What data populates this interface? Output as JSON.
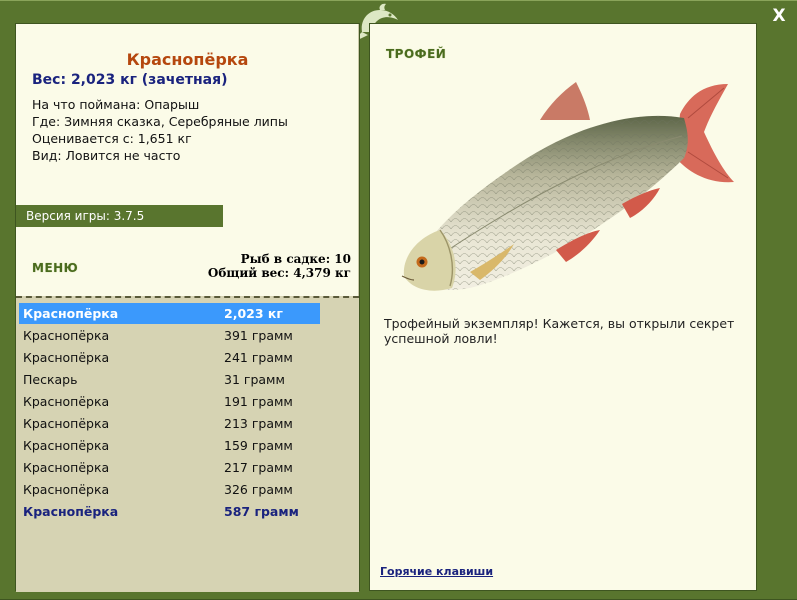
{
  "window": {
    "close_label": "X",
    "logo_icon": "fish-logo-icon"
  },
  "fish": {
    "name": "Краснопёрка",
    "weight": "Вес: 2,023 кг (зачетная)",
    "bait": "На что поймана: Опарыш",
    "location": "Где: Зимняя сказка, Серебряные липы",
    "rated_from": "Оценивается с: 1,651 кг",
    "species_note": "Вид: Ловится не часто"
  },
  "version": "Версия игры: 3.7.5",
  "menu_label": "МЕНЮ",
  "keepnet": {
    "count": "Рыб в садке: 10",
    "total_weight": "Общий вес: 4,379 кг"
  },
  "catch_list": [
    {
      "name": "Краснопёрка",
      "weight": "2,023 кг",
      "state": "selected"
    },
    {
      "name": "Краснопёрка",
      "weight": "391 грамм",
      "state": "normal"
    },
    {
      "name": "Краснопёрка",
      "weight": "241 грамм",
      "state": "normal"
    },
    {
      "name": "Пескарь",
      "weight": "31 грамм",
      "state": "normal"
    },
    {
      "name": "Краснопёрка",
      "weight": "191 грамм",
      "state": "normal"
    },
    {
      "name": "Краснопёрка",
      "weight": "213 грамм",
      "state": "normal"
    },
    {
      "name": "Краснопёрка",
      "weight": "159 грамм",
      "state": "normal"
    },
    {
      "name": "Краснопёрка",
      "weight": "217 грамм",
      "state": "normal"
    },
    {
      "name": "Краснопёрка",
      "weight": "326 грамм",
      "state": "normal"
    },
    {
      "name": "Краснопёрка",
      "weight": "587 грамм",
      "state": "highlighted"
    }
  ],
  "trophy": {
    "label": "ТРОФЕЙ",
    "description": "Трофейный экземпляр! Кажется, вы открыли секрет успешной ловли!",
    "image_icon": "rudd-fish-image"
  },
  "hotkeys_link": "Горячие клавиши",
  "colors": {
    "frame": "#59752e",
    "panel": "#fbfbe8",
    "list_bg": "#d6d3b3",
    "title": "#b5470e",
    "navy": "#1a237e",
    "selected": "#3b99fc"
  }
}
